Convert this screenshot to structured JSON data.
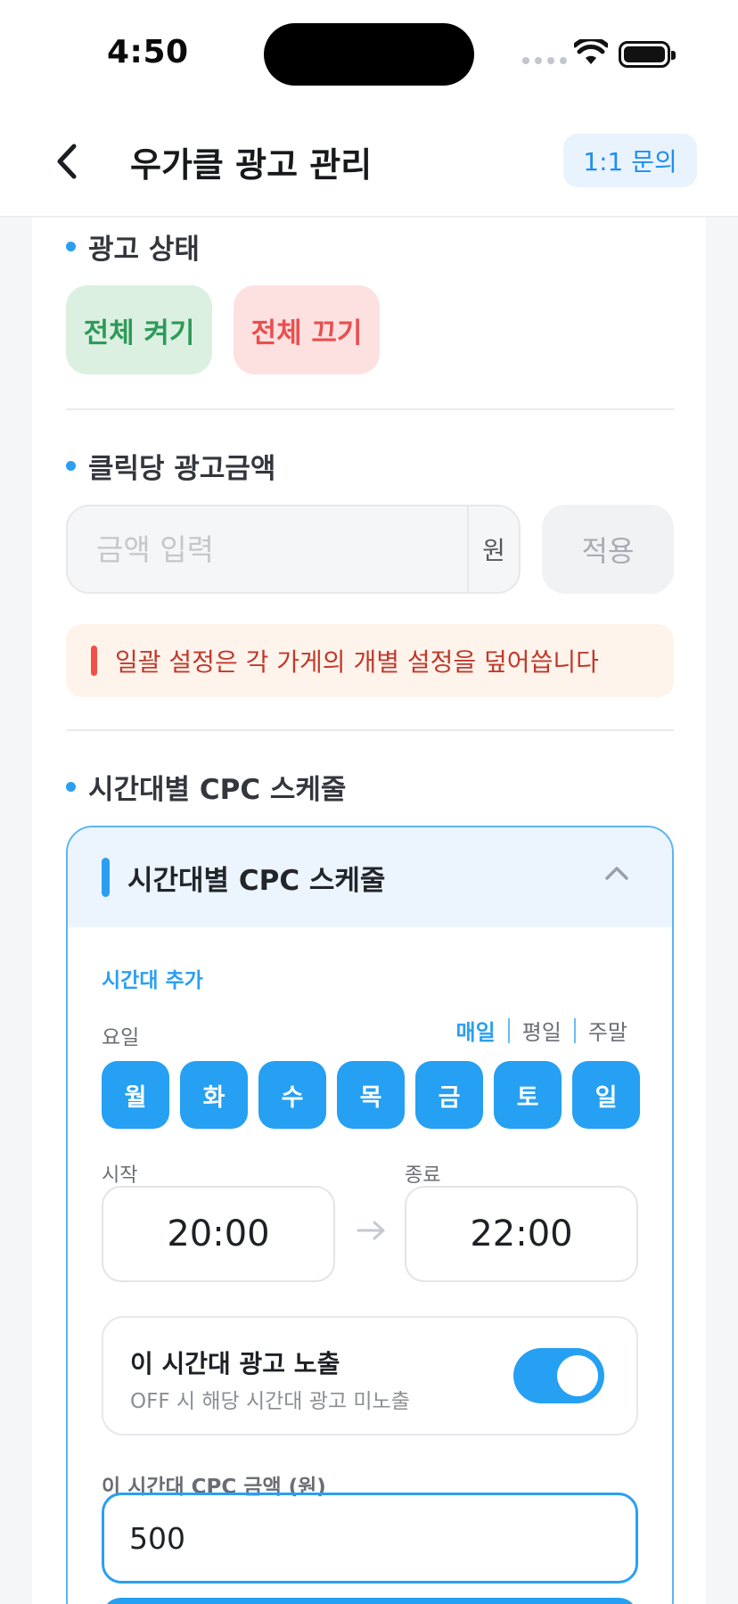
{
  "status": {
    "time": "4:50"
  },
  "header": {
    "title": "우가클 광고 관리",
    "inquiry_label": "1:1 문의"
  },
  "ad_status": {
    "title": "광고 상태",
    "on_label": "전체 켜기",
    "off_label": "전체 끄기"
  },
  "cpc": {
    "title": "클릭당 광고금액",
    "placeholder": "금액 입력",
    "unit": "원",
    "apply_label": "적용",
    "notice": "일괄 설정은 각 가게의 개별 설정을 덮어씁니다"
  },
  "schedule": {
    "section_title": "시간대별 CPC 스케줄",
    "box_title": "시간대별 CPC 스케줄",
    "add_label": "시간대 추가",
    "day_label": "요일",
    "filters": [
      "매일",
      "평일",
      "주말"
    ],
    "days": [
      "월",
      "화",
      "수",
      "목",
      "금",
      "토",
      "일"
    ],
    "start_label": "시작",
    "end_label": "종료",
    "start_time": "20:00",
    "end_time": "22:00",
    "exposure_title": "이 시간대 광고 노출",
    "exposure_sub": "OFF 시 해당 시간대 광고 미노출",
    "exposure_on": true,
    "cpc_label": "이 시간대 CPC 금액 (원)",
    "cpc_value": "500"
  },
  "colors": {
    "accent": "#2a9ff2",
    "on_green": "#2e9a58",
    "off_red": "#ea4f4f"
  }
}
